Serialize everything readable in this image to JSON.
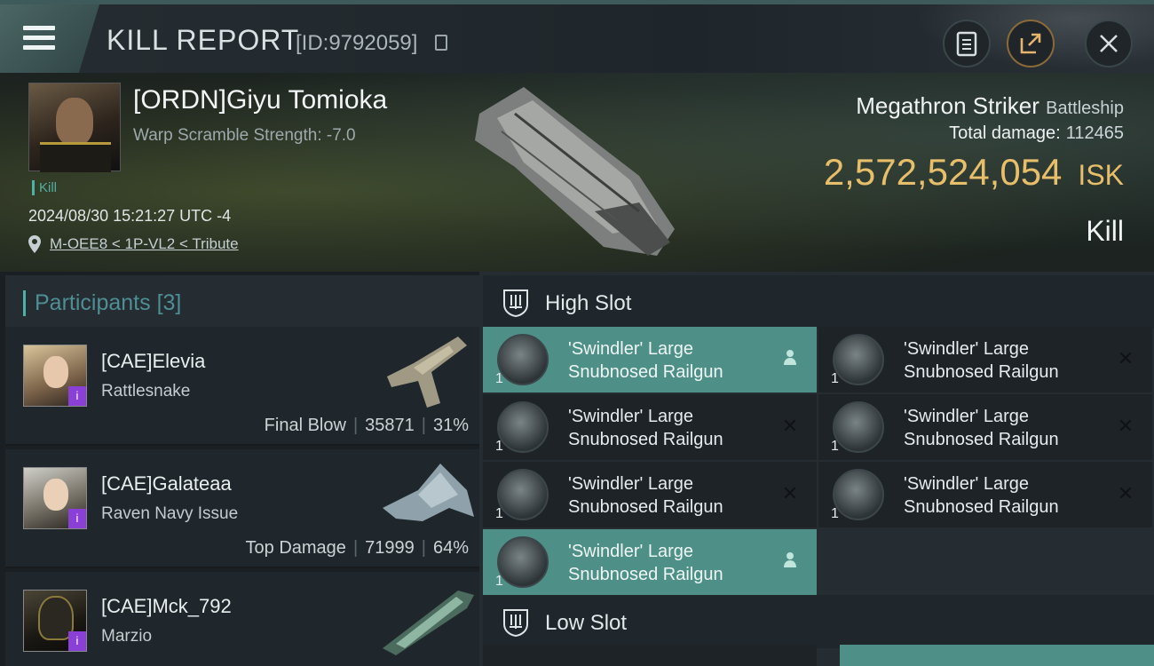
{
  "header": {
    "title": "KILL REPORT",
    "report_id": "[ID:9792059]"
  },
  "victim": {
    "name": "[ORDN]Giyu Tomioka",
    "warp_scramble": "Warp Scramble Strength: -7.0",
    "tag": "Kill",
    "timestamp": "2024/08/30 15:21:27 UTC -4",
    "location": "M-OEE8 < 1P-VL2 < Tribute",
    "ship_name": "Megathron Striker",
    "ship_class": "Battleship",
    "total_damage_label": "Total damage:",
    "total_damage": "112465",
    "isk_value": "2,572,524,054",
    "isk_unit": "ISK",
    "status": "Kill"
  },
  "participants": {
    "label": "Participants",
    "count": "[3]",
    "items": [
      {
        "name": "[CAE]Elevia",
        "ship": "Rattlesnake",
        "role": "Final Blow",
        "damage": "35871",
        "percent": "31%",
        "badge": "i"
      },
      {
        "name": "[CAE]Galateaa",
        "ship": "Raven Navy Issue",
        "role": "Top Damage",
        "damage": "71999",
        "percent": "64%",
        "badge": "i"
      },
      {
        "name": "[CAE]Mck_792",
        "ship": "Marzio",
        "badge": "i"
      }
    ]
  },
  "fitting": {
    "high_slot_label": "High Slot",
    "low_slot_label": "Low Slot",
    "high_slots": [
      {
        "qty": "1",
        "line1": "'Swindler' Large",
        "line2": "Snubnosed Railgun",
        "state": "dropped"
      },
      {
        "qty": "1",
        "line1": "'Swindler' Large",
        "line2": "Snubnosed Railgun",
        "state": "destroyed"
      },
      {
        "qty": "1",
        "line1": "'Swindler' Large",
        "line2": "Snubnosed Railgun",
        "state": "destroyed"
      },
      {
        "qty": "1",
        "line1": "'Swindler' Large",
        "line2": "Snubnosed Railgun",
        "state": "destroyed"
      },
      {
        "qty": "1",
        "line1": "'Swindler' Large",
        "line2": "Snubnosed Railgun",
        "state": "destroyed"
      },
      {
        "qty": "1",
        "line1": "'Swindler' Large",
        "line2": "Snubnosed Railgun",
        "state": "destroyed"
      },
      {
        "qty": "1",
        "line1": "'Swindler' Large",
        "line2": "Snubnosed Railgun",
        "state": "dropped"
      }
    ]
  },
  "colors": {
    "accent_teal": "#4fb0a4",
    "isk_gold": "#e7be6a",
    "dropped_bg": "#4e9088"
  }
}
